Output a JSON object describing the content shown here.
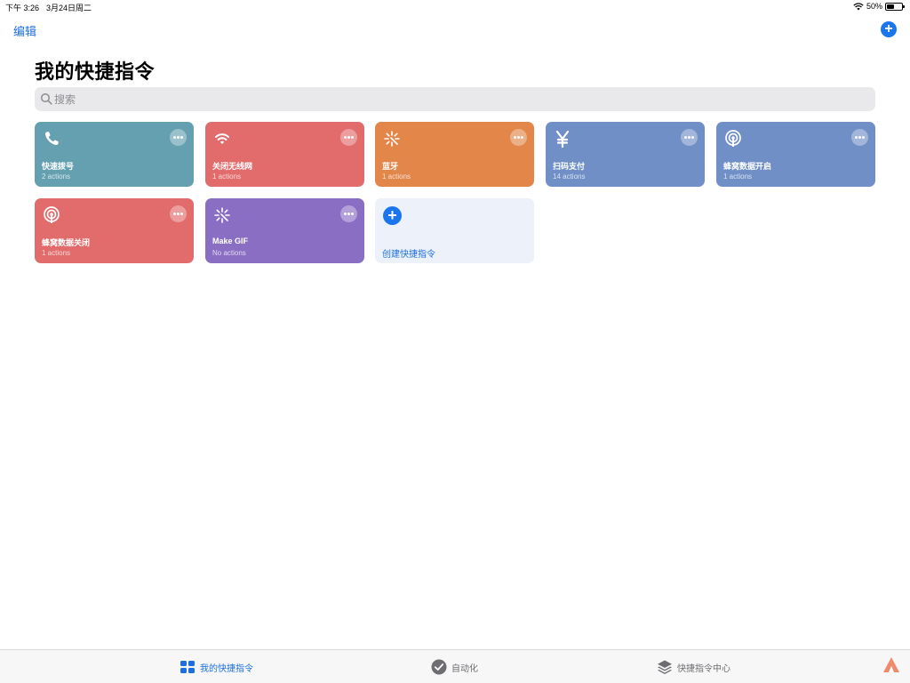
{
  "status_bar": {
    "time": "下午 3:26",
    "date": "3月24日周二",
    "battery_text": "50%",
    "battery_level": 0.5
  },
  "nav": {
    "edit_label": "编辑",
    "add_label": "+"
  },
  "page_title": "我的快捷指令",
  "search": {
    "placeholder": "搜索"
  },
  "shortcuts": [
    {
      "name": "快速拨号",
      "actions": "2 actions",
      "icon": "phone-icon",
      "color": "#64a0af"
    },
    {
      "name": "关闭无线网",
      "actions": "1 actions",
      "icon": "wifi-icon",
      "color": "#e26b6c"
    },
    {
      "name": "蓝牙",
      "actions": "1 actions",
      "icon": "sparkle-icon",
      "color": "#e2864a"
    },
    {
      "name": "扫码支付",
      "actions": "14 actions",
      "icon": "yen-icon",
      "color": "#6f8fc6"
    },
    {
      "name": "蜂窝数据开启",
      "actions": "1 actions",
      "icon": "cellular-icon",
      "color": "#6f8fc6"
    },
    {
      "name": "蜂窝数据关闭",
      "actions": "1 actions",
      "icon": "cellular-icon",
      "color": "#e26b6c"
    },
    {
      "name": "Make GIF",
      "actions": "No actions",
      "icon": "sparkle-icon",
      "color": "#8a6ec4"
    }
  ],
  "create_card": {
    "label": "创建快捷指令",
    "plus": "+"
  },
  "tabs": [
    {
      "label": "我的快捷指令",
      "icon": "grid-icon",
      "active": true
    },
    {
      "label": "自动化",
      "icon": "check-circle-icon",
      "active": false
    },
    {
      "label": "快捷指令中心",
      "icon": "layers-icon",
      "active": false
    }
  ],
  "colors": {
    "accent": "#1b76ee",
    "search_bg": "#e9e9eb",
    "tab_bar_bg": "#f7f7f7"
  }
}
